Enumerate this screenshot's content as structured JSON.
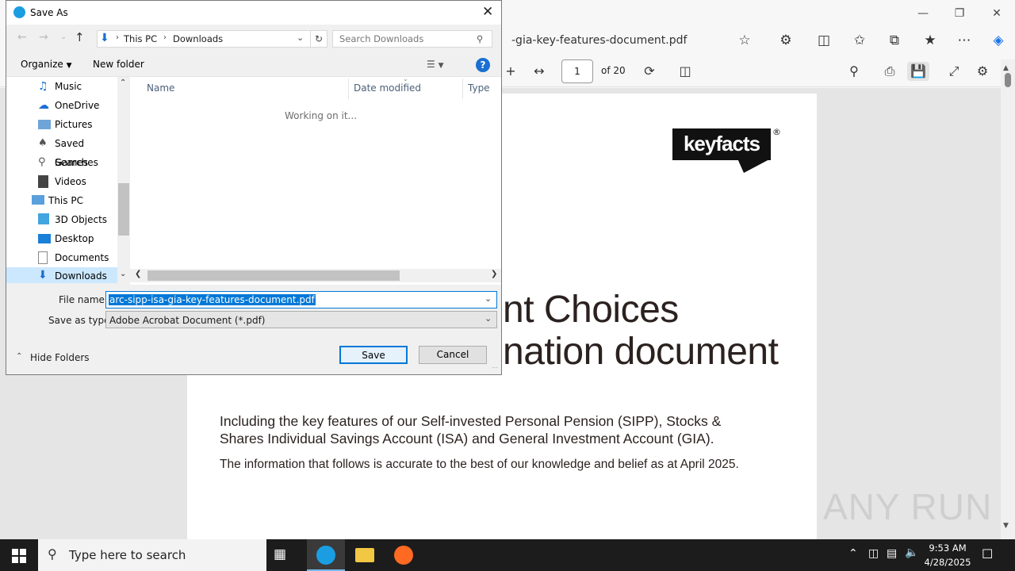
{
  "browser": {
    "tab_title": "arc-sipp-isa-gia-key-features-document.pdf",
    "tab_title_visible": "-gia-key-features-document.pdf",
    "page_current": "1",
    "page_total": "of 20"
  },
  "document": {
    "logo_text": "keyfacts",
    "logo_mark": "®",
    "heading_line1": "nt Choices",
    "heading_line2": "nation document",
    "para1_line1": "Including the key features of our Self-invested Personal Pension (SIPP), Stocks &",
    "para1_line2": "Shares Individual Savings Account (ISA) and General Investment Account (GIA).",
    "para2": "The information that follows is accurate to the best of our knowledge and belief as at April 2025.",
    "watermark": "ANY RUN"
  },
  "dialog": {
    "title": "Save As",
    "breadcrumb": [
      "This PC",
      "Downloads"
    ],
    "search_placeholder": "Search Downloads",
    "organize_label": "Organize",
    "new_folder_label": "New folder",
    "nav_items": [
      {
        "label": "Music",
        "icon": "music-icon"
      },
      {
        "label": "OneDrive",
        "icon": "cloud-icon"
      },
      {
        "label": "Pictures",
        "icon": "pictures-icon"
      },
      {
        "label": "Saved Games",
        "icon": "saved-games-icon"
      },
      {
        "label": "Searches",
        "icon": "search-icon"
      },
      {
        "label": "Videos",
        "icon": "videos-icon"
      },
      {
        "label": "This PC",
        "icon": "computer-icon"
      },
      {
        "label": "3D Objects",
        "icon": "cube-icon"
      },
      {
        "label": "Desktop",
        "icon": "desktop-icon"
      },
      {
        "label": "Documents",
        "icon": "documents-icon"
      },
      {
        "label": "Downloads",
        "icon": "download-icon"
      }
    ],
    "columns": [
      "Name",
      "Date modified",
      "Type"
    ],
    "status_text": "Working on it...",
    "file_name_label": "File name:",
    "file_name_value": "arc-sipp-isa-gia-key-features-document.pdf",
    "save_type_label": "Save as type:",
    "save_type_value": "Adobe Acrobat Document (*.pdf)",
    "hide_folders_label": "Hide Folders",
    "save_label": "Save",
    "cancel_label": "Cancel"
  },
  "taskbar": {
    "search_placeholder": "Type here to search",
    "time": "9:53 AM",
    "date": "4/28/2025"
  },
  "colors": {
    "accent": "#0078d7",
    "selection": "#0078d7",
    "taskbar": "#1c1c1c",
    "heading_text": "#2b2220"
  }
}
